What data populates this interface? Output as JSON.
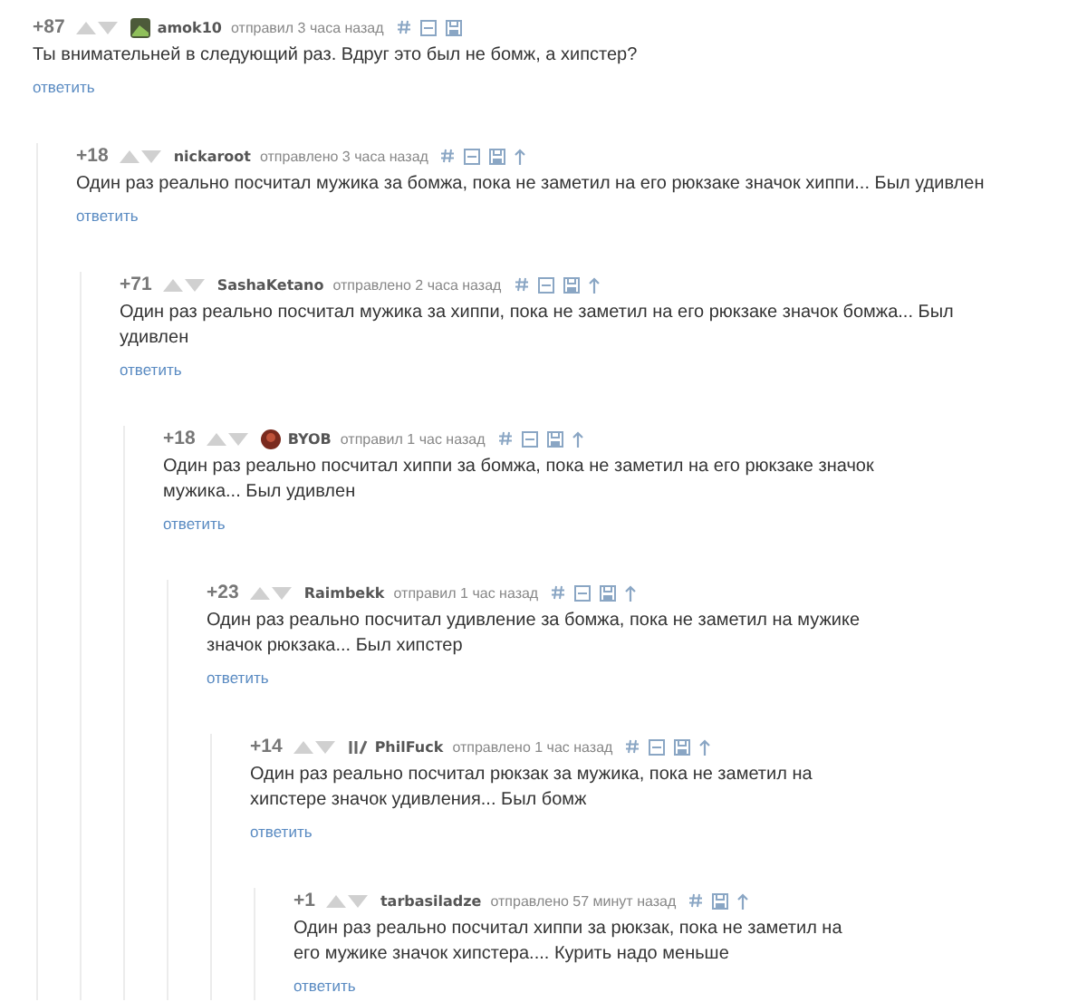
{
  "comment": {
    "rating": "+87",
    "avatar": {
      "kind": "square"
    },
    "author": "amok10",
    "posted": "отправил 3 часа назад",
    "collapsible": true,
    "parent_link": false,
    "text": "Ты внимательней в следующий раз. Вдруг это был не бомж, а хипстер?",
    "reply": "ответить",
    "children": [
      {
        "rating": "+18",
        "author": "nickaroot",
        "posted": "отправлено 3 часа назад",
        "collapsible": true,
        "parent_link": true,
        "text": "Один раз реально посчитал мужика за бомжа, пока не заметил на его рюкзаке значок хиппи... Был удивлен",
        "reply": "ответить",
        "children": [
          {
            "rating": "+71",
            "author": "SashaKetano",
            "posted": "отправлено 2 часа назад",
            "collapsible": true,
            "parent_link": true,
            "text": "Один раз реально посчитал мужика за хиппи, пока не заметил на его рюкзаке значок бомжа... Был удивлен",
            "reply": "ответить",
            "children": [
              {
                "rating": "+18",
                "avatar": {
                  "kind": "round"
                },
                "author": "BYOB",
                "posted": "отправил 1 час назад",
                "collapsible": true,
                "parent_link": true,
                "text": "Один раз реально посчитал хиппи за бомжа, пока не заметил на его рюкзаке значок мужика... Был удивлен",
                "reply": "ответить",
                "children": [
                  {
                    "rating": "+23",
                    "author": "Raimbekk",
                    "posted": "отправил 1 час назад",
                    "collapsible": true,
                    "parent_link": true,
                    "text": "Один раз реально посчитал удивление за бомжа, пока не заметил на мужике значок рюкзака... Был хипстер",
                    "reply": "ответить",
                    "children": [
                      {
                        "rating": "+14",
                        "avatar": {
                          "kind": "mark"
                        },
                        "author": "PhilFuck",
                        "posted": "отправлено 1 час назад",
                        "collapsible": true,
                        "parent_link": true,
                        "text": "Один раз реально посчитал рюкзак за мужика, пока не заметил на хипстере значок удивления... Был бомж",
                        "reply": "ответить",
                        "children": [
                          {
                            "rating": "+1",
                            "author": "tarbasiladze",
                            "posted": "отправлено 57 минут назад",
                            "collapsible": false,
                            "parent_link": true,
                            "text": "Один раз реально посчитал хиппи за рюкзак, пока не заметил на его мужике значок хипстера.... Курить надо меньше",
                            "reply": "ответить"
                          }
                        ]
                      }
                    ]
                  }
                ]
              }
            ]
          }
        ]
      }
    ]
  }
}
